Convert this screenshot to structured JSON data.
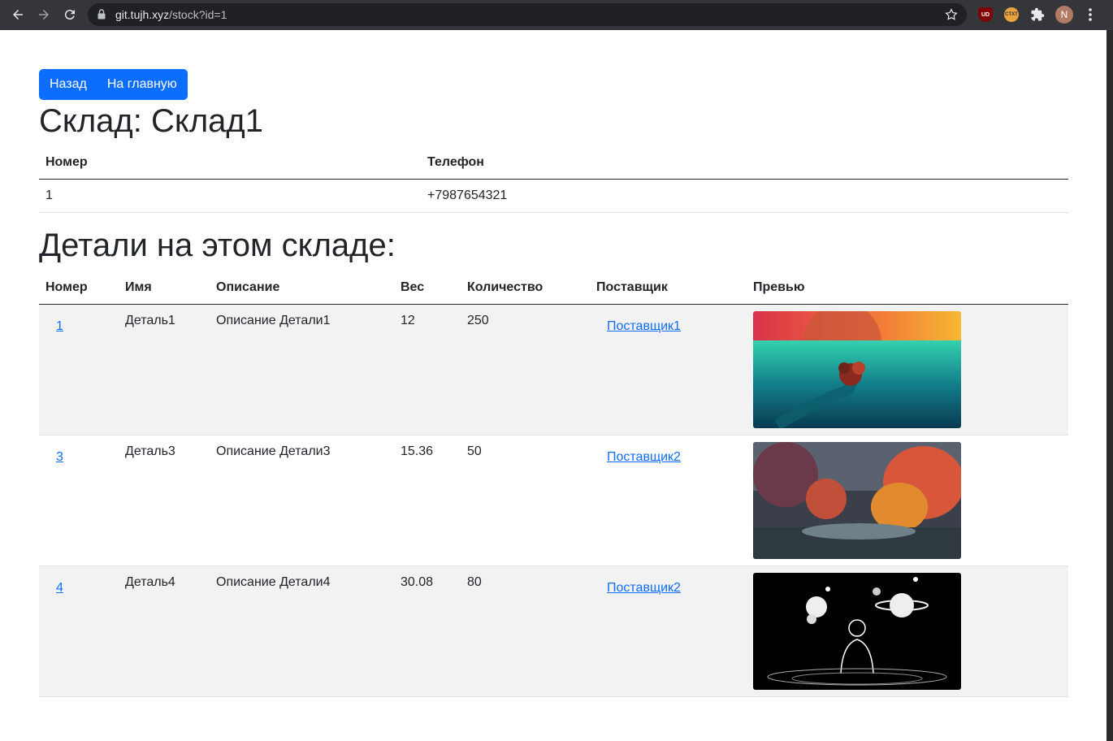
{
  "browser": {
    "url_host": "git.tujh.xyz",
    "url_path": "/stock?id=1",
    "ext_ublock": "UD",
    "ext_ctxt": "CTXT",
    "avatar_letter": "N"
  },
  "nav": {
    "back_label": "Назад",
    "home_label": "На главную"
  },
  "stock": {
    "title": "Склад: Склад1",
    "headers": {
      "number": "Номер",
      "phone": "Телефон"
    },
    "row": {
      "number": "1",
      "phone": "+7987654321"
    }
  },
  "parts": {
    "title": "Детали на этом складе:",
    "headers": {
      "number": "Номер",
      "name": "Имя",
      "description": "Описание",
      "weight": "Вес",
      "quantity": "Количество",
      "supplier": "Поставщик",
      "preview": "Превью"
    },
    "rows": [
      {
        "number": "1",
        "name": "Деталь1",
        "description": "Описание Детали1",
        "weight": "12",
        "quantity": "250",
        "supplier": "Поставщик1",
        "preview": "underwater-whale-artwork"
      },
      {
        "number": "3",
        "name": "Деталь3",
        "description": "Описание Детали3",
        "weight": "15.36",
        "quantity": "50",
        "supplier": "Поставщик2",
        "preview": "autumn-forest-artwork"
      },
      {
        "number": "4",
        "name": "Деталь4",
        "description": "Описание Детали4",
        "weight": "30.08",
        "quantity": "80",
        "supplier": "Поставщик2",
        "preview": "space-planets-artwork"
      }
    ]
  },
  "colors": {
    "primary": "#0d6efd",
    "stripe": "#f2f2f2",
    "chrome_bg": "#35363a"
  }
}
